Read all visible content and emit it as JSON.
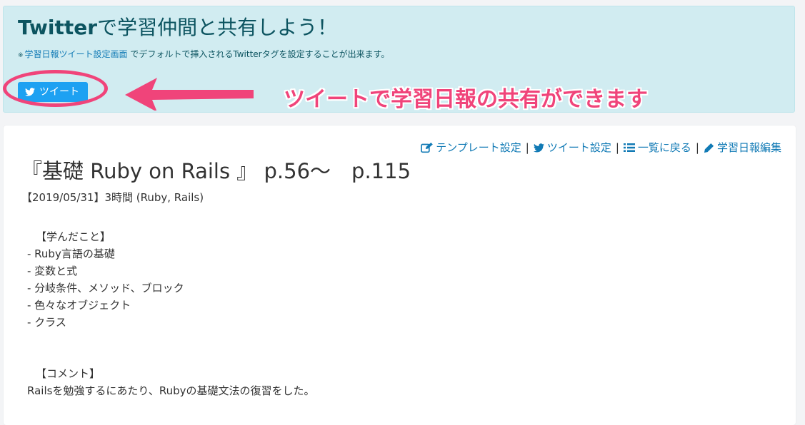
{
  "share_panel": {
    "title_strong": "Twitter",
    "title_rest": "で学習仲間と共有しよう！",
    "note_mark": "※",
    "note_link": "学習日報ツイート設定画面",
    "note_text": " でデフォルトで挿入されるTwitterタグを設定することが出来ます。",
    "tweet_button_label": "ツイート"
  },
  "annotation": {
    "text": "ツイートで学習日報の共有ができます",
    "color": "#f0447a"
  },
  "report": {
    "actions": [
      {
        "icon": "edit-icon",
        "label": "テンプレート設定"
      },
      {
        "icon": "twitter-icon",
        "label": "ツイート設定"
      },
      {
        "icon": "list-icon",
        "label": "一覧に戻る"
      },
      {
        "icon": "pencil-icon",
        "label": "学習日報編集"
      }
    ],
    "separator": "|",
    "title": "『基礎 Ruby on Rails 』 p.56〜　p.115",
    "meta": "【2019/05/31】3時間 (Ruby, Rails)",
    "body": {
      "learned_heading": "【学んだこと】",
      "learned_items": [
        "- Ruby言語の基礎",
        "- 変数と式",
        "- 分岐条件、メソッド、ブロック",
        "- 色々なオブジェクト",
        "- クラス"
      ],
      "comment_heading": "【コメント】",
      "comment_text": "Railsを勉強するにあたり、Rubyの基礎文法の復習をした。"
    }
  },
  "colors": {
    "panel_background": "#d1ecf1",
    "panel_text": "#0c5460",
    "link": "#117ab5",
    "tweet_button": "#1da1f2",
    "annotation": "#f0447a"
  }
}
